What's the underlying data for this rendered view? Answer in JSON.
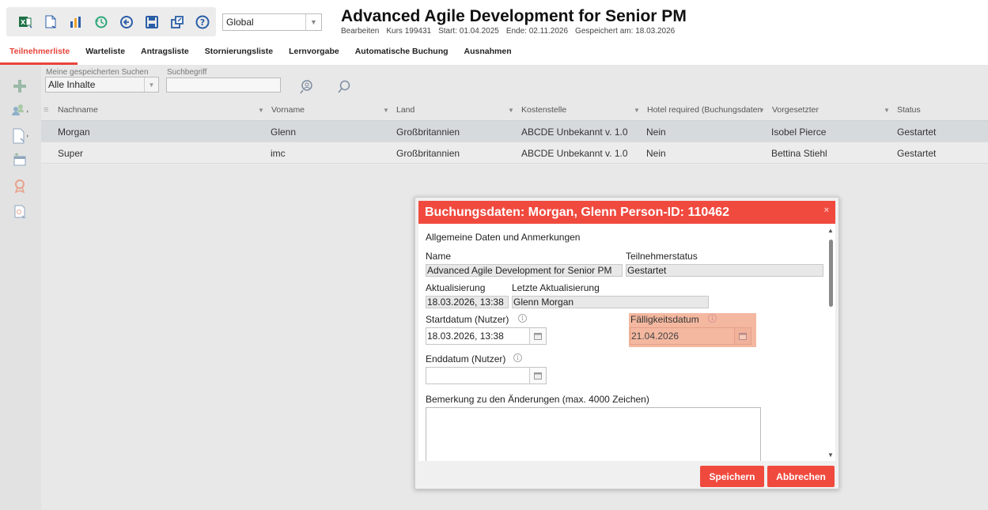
{
  "header": {
    "scope_value": "Global",
    "title": "Advanced Agile Development for Senior PM",
    "subline": [
      "Bearbeiten",
      "Kurs 199431",
      "Start: 01.04.2025",
      "Ende: 02.11.2026",
      "Gespeichert am: 18.03.2026"
    ]
  },
  "tabs": [
    {
      "label": "Teilnehmerliste",
      "active": true
    },
    {
      "label": "Warteliste"
    },
    {
      "label": "Antragsliste"
    },
    {
      "label": "Stornierungsliste"
    },
    {
      "label": "Lernvorgabe"
    },
    {
      "label": "Automatische Buchung"
    },
    {
      "label": "Ausnahmen"
    }
  ],
  "search": {
    "saved_label": "Meine gespeicherten Suchen",
    "saved_value": "Alle Inhalte",
    "term_label": "Suchbegriff",
    "term_value": ""
  },
  "table": {
    "columns": [
      "Nachname",
      "Vorname",
      "Land",
      "Kostenstelle",
      "Hotel required (Buchungsdaten",
      "Vorgesetzter",
      "Status"
    ],
    "rows": [
      [
        "Morgan",
        "Glenn",
        "Großbritannien",
        "ABCDE Unbekannt v. 1.0",
        "Nein",
        "Isobel Pierce",
        "Gestartet"
      ],
      [
        "Super",
        "imc",
        "Großbritannien",
        "ABCDE Unbekannt v. 1.0",
        "Nein",
        "Bettina Stiehl",
        "Gestartet"
      ]
    ]
  },
  "modal": {
    "title": "Buchungsdaten: Morgan, Glenn Person-ID: 110462",
    "close": "×",
    "section": "Allgemeine Daten und Anmerkungen",
    "name_label": "Name",
    "name_value": "Advanced Agile Development for Senior PM",
    "status_label": "Teilnehmerstatus",
    "status_value": "Gestartet",
    "update_label": "Aktualisierung",
    "update_value": "18.03.2026, 13:38",
    "last_update_label": "Letzte Aktualisierung",
    "last_update_value": "Glenn Morgan",
    "start_label": "Startdatum (Nutzer)",
    "start_value": "18.03.2026, 13:38",
    "due_label": "Fälligkeitsdatum",
    "due_value": "21.04.2026",
    "end_label": "Enddatum (Nutzer)",
    "end_value": "",
    "remark_label": "Bemerkung zu den Änderungen (max. 4000 Zeichen)",
    "save": "Speichern",
    "cancel": "Abbrechen"
  },
  "colors": {
    "accent": "#f04a3f",
    "highlight": "#f4b8a0"
  }
}
